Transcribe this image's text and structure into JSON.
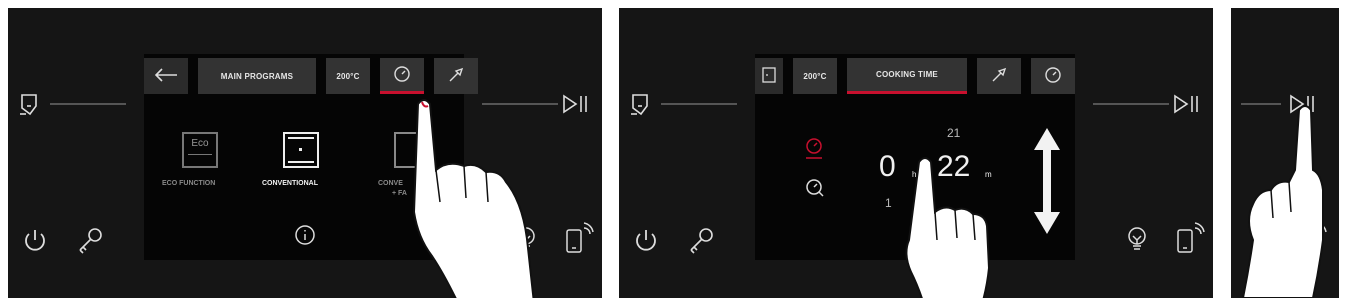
{
  "panel1": {
    "tabs": {
      "main_programs": "MAIN PROGRAMS",
      "temperature": "200°C"
    },
    "programs": [
      {
        "icon_text": "Eco",
        "label": "ECO FUNCTION"
      },
      {
        "label": "CONVENTIONAL"
      },
      {
        "label": "CONVE",
        "label2": "+ FA"
      }
    ],
    "icons": [
      "oven-door-icon",
      "power-icon",
      "key-icon",
      "back-arrow-icon",
      "timer-icon",
      "probe-icon",
      "info-icon",
      "play-pause-icon",
      "lamp-icon",
      "phone-wifi-icon"
    ]
  },
  "panel2": {
    "tabs": {
      "temperature": "200°C",
      "cooking_time": "COOKING TIME"
    },
    "time": {
      "hours": "0",
      "hours_unit": "h",
      "minutes": "22",
      "minutes_unit": "m",
      "above": "21",
      "below": "1"
    }
  },
  "colors": {
    "accent": "#c8102e",
    "panel": "#151515",
    "screen": "#050505",
    "tab": "#333333"
  }
}
